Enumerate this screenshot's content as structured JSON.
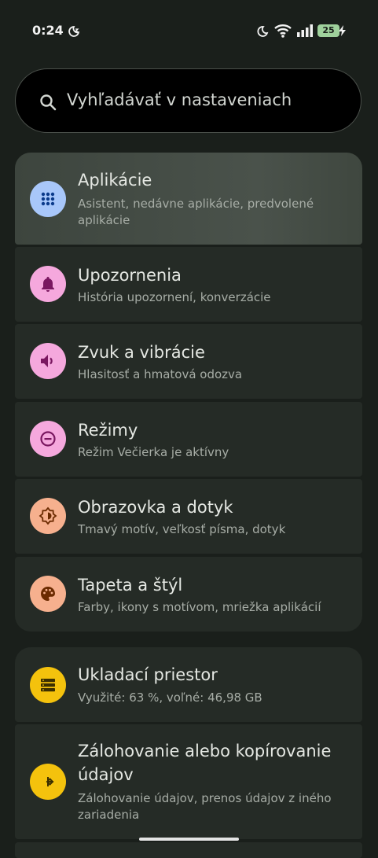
{
  "status": {
    "time": "0:24",
    "battery": "25"
  },
  "search": {
    "placeholder": "Vyhľadávať v nastaveniach"
  },
  "groups": [
    {
      "items": [
        {
          "title": "Aplikácie",
          "subtitle": "Asistent, nedávne aplikácie, predvolené aplikácie",
          "icon": "apps-grid-icon",
          "color": "#a8c7fa"
        },
        {
          "title": "Upozornenia",
          "subtitle": "História upozornení, konverzácie",
          "icon": "bell-icon",
          "color": "#f5a8dd"
        },
        {
          "title": "Zvuk a vibrácie",
          "subtitle": "Hlasitosť a hmatová odozva",
          "icon": "volume-icon",
          "color": "#f5a8dd"
        },
        {
          "title": "Režimy",
          "subtitle": "Režim Večierka je aktívny",
          "icon": "do-not-disturb-icon",
          "color": "#f5a8dd"
        },
        {
          "title": "Obrazovka a dotyk",
          "subtitle": "Tmavý motív, veľkosť písma, dotyk",
          "icon": "brightness-icon",
          "color": "#f6b08e"
        },
        {
          "title": "Tapeta a štýl",
          "subtitle": "Farby, ikony s motívom, mriežka aplikácií",
          "icon": "palette-icon",
          "color": "#f6b08e"
        }
      ]
    },
    {
      "items": [
        {
          "title": "Ukladací priestor",
          "subtitle": "Využité: 63 %, voľné: 46,98 GB",
          "icon": "storage-icon",
          "color": "#f4c20d"
        },
        {
          "title": "Zálohovanie alebo kopírovanie údajov",
          "title_line1": "Zálohovanie alebo kopírovanie",
          "title_line2": "údajov",
          "subtitle": "Zálohovanie údajov, prenos údajov z iného zariadenia",
          "icon": "transfer-icon",
          "color": "#f4c20d"
        }
      ]
    }
  ]
}
